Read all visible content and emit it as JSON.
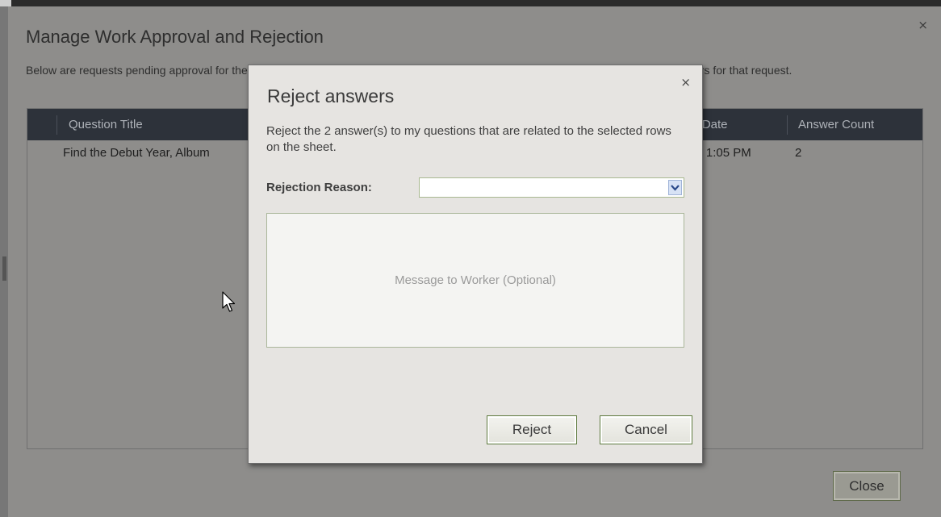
{
  "background_dialog": {
    "title": "Manage Work Approval and Rejection",
    "description": "Below are requests pending approval for the 2 row(s) selected on the sheet. Right click an item to approve or reject the selected answers for that request.",
    "close_glyph": "×",
    "table": {
      "columns": [
        "Question Title",
        "st Date",
        "Answer Count"
      ],
      "rows": [
        {
          "question_title": "Find the Debut Year, Album",
          "request_date": "09 1:05 PM",
          "answer_count": "2"
        }
      ]
    },
    "close_button_label": "Close"
  },
  "modal": {
    "title": "Reject answers",
    "close_glyph": "×",
    "description": "Reject the 2 answer(s) to my questions that are related to the selected rows on the sheet.",
    "rejection_reason_label": "Rejection Reason:",
    "rejection_reason_value": "",
    "message_placeholder": "Message to Worker (Optional)",
    "reject_button_label": "Reject",
    "cancel_button_label": "Cancel"
  },
  "colors": {
    "overlay": "#8e8d8b",
    "header_bg": "#2d323a",
    "modal_bg": "#e6e4e1",
    "button_border": "#5e7a3e"
  },
  "icons": {
    "select_arrow": "chevron-down-icon",
    "cursor": "mouse-pointer-icon"
  }
}
